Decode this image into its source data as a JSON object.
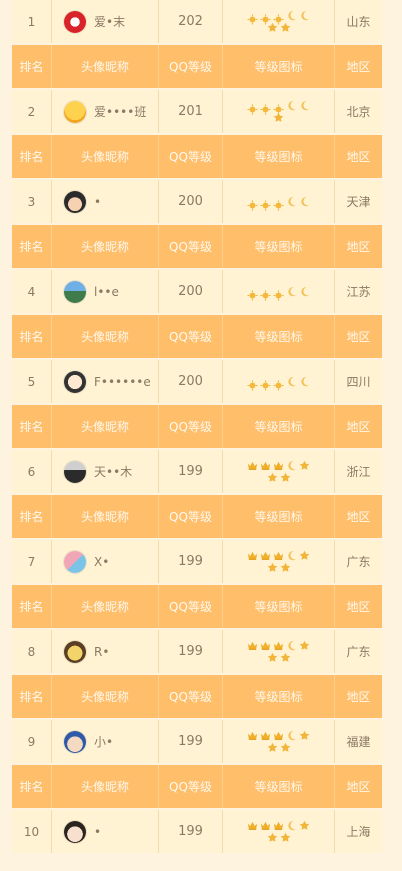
{
  "header": {
    "rank": "排名",
    "nick": "头像昵称",
    "level": "QQ等级",
    "icon": "等级图标",
    "region": "地区"
  },
  "rows": [
    {
      "rank": "1",
      "nick": "爱•末",
      "level": "202",
      "region": "山东",
      "avatar": "red-seal",
      "icons": [
        "sun",
        "sun",
        "sun",
        "moon",
        "moon",
        "star",
        "star"
      ]
    },
    {
      "rank": "2",
      "nick": "爱••••班",
      "level": "201",
      "region": "北京",
      "avatar": "cat-yellow",
      "icons": [
        "sun",
        "sun",
        "sun",
        "moon",
        "moon",
        "star"
      ]
    },
    {
      "rank": "3",
      "nick": "•",
      "level": "200",
      "region": "天津",
      "avatar": "face-dark",
      "icons": [
        "sun",
        "sun",
        "sun",
        "moon",
        "moon"
      ]
    },
    {
      "rank": "4",
      "nick": "l••e",
      "level": "200",
      "region": "江苏",
      "avatar": "landscape",
      "icons": [
        "sun",
        "sun",
        "sun",
        "moon",
        "moon"
      ]
    },
    {
      "rank": "5",
      "nick": "F••••••e",
      "level": "200",
      "region": "四川",
      "avatar": "cartoon-face",
      "icons": [
        "sun",
        "sun",
        "sun",
        "moon",
        "moon"
      ]
    },
    {
      "rank": "6",
      "nick": "天••木",
      "level": "199",
      "region": "浙江",
      "avatar": "person-dark",
      "icons": [
        "crown",
        "crown",
        "crown",
        "moon",
        "star",
        "star",
        "star"
      ]
    },
    {
      "rank": "7",
      "nick": "X•",
      "level": "199",
      "region": "广东",
      "avatar": "sticker",
      "icons": [
        "crown",
        "crown",
        "crown",
        "moon",
        "star",
        "star",
        "star"
      ]
    },
    {
      "rank": "8",
      "nick": "R•",
      "level": "199",
      "region": "广东",
      "avatar": "bear",
      "icons": [
        "crown",
        "crown",
        "crown",
        "moon",
        "star",
        "star",
        "star"
      ]
    },
    {
      "rank": "9",
      "nick": "小•",
      "level": "199",
      "region": "福建",
      "avatar": "boy-cartoon",
      "icons": [
        "crown",
        "crown",
        "crown",
        "moon",
        "star",
        "star",
        "star"
      ]
    },
    {
      "rank": "10",
      "nick": "•",
      "level": "199",
      "region": "上海",
      "avatar": "anime-boy",
      "icons": [
        "crown",
        "crown",
        "crown",
        "moon",
        "star",
        "star",
        "star"
      ]
    }
  ],
  "colors": {
    "header_bg": "#ffbe6a",
    "row_bg": "#fff3d3",
    "page_bg": "#fdf3df",
    "text": "#8a7a64",
    "header_text": "#fff9ee"
  }
}
